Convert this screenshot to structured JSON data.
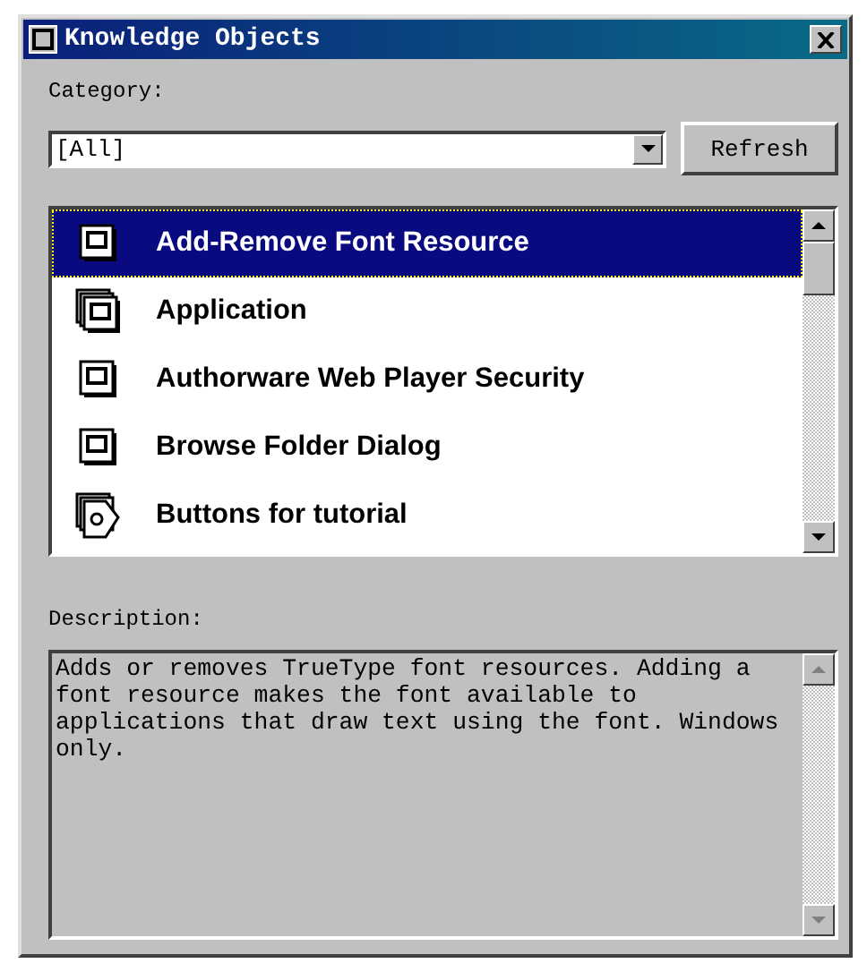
{
  "window": {
    "title": "Knowledge Objects"
  },
  "category": {
    "label": "Category:",
    "value": "[All]"
  },
  "refresh_button": "Refresh",
  "objects": [
    {
      "name": "Add-Remove Font Resource",
      "kind": "single",
      "selected": true
    },
    {
      "name": "Application",
      "kind": "stack",
      "selected": false
    },
    {
      "name": "Authorware Web Player Security",
      "kind": "single",
      "selected": false
    },
    {
      "name": "Browse Folder Dialog",
      "kind": "single",
      "selected": false
    },
    {
      "name": "Buttons for tutorial",
      "kind": "help",
      "selected": false
    }
  ],
  "description": {
    "label": "Description:",
    "text": "Adds or removes TrueType font resources. Adding a font resource makes the font available to applications that draw text using the font. Windows only."
  }
}
